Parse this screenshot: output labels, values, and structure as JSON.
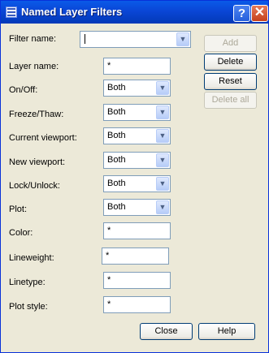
{
  "window": {
    "title": "Named Layer Filters",
    "help_glyph": "?",
    "close_glyph": "✕"
  },
  "labels": {
    "filter_name": "Filter name:",
    "layer_name": "Layer name:",
    "on_off": "On/Off:",
    "freeze_thaw": "Freeze/Thaw:",
    "current_viewport": "Current viewport:",
    "new_viewport": "New viewport:",
    "lock_unlock": "Lock/Unlock:",
    "plot": "Plot:",
    "color": "Color:",
    "lineweight": "Lineweight:",
    "linetype": "Linetype:",
    "plot_style": "Plot style:"
  },
  "values": {
    "filter_name": "",
    "layer_name": "*",
    "on_off": "Both",
    "freeze_thaw": "Both",
    "current_viewport": "Both",
    "new_viewport": "Both",
    "lock_unlock": "Both",
    "plot": "Both",
    "color": "*",
    "lineweight": "*",
    "linetype": "*",
    "plot_style": "*"
  },
  "buttons": {
    "add": "Add",
    "delete": "Delete",
    "reset": "Reset",
    "delete_all": "Delete all",
    "close": "Close",
    "help": "Help"
  },
  "dropdown_arrow": "▼"
}
